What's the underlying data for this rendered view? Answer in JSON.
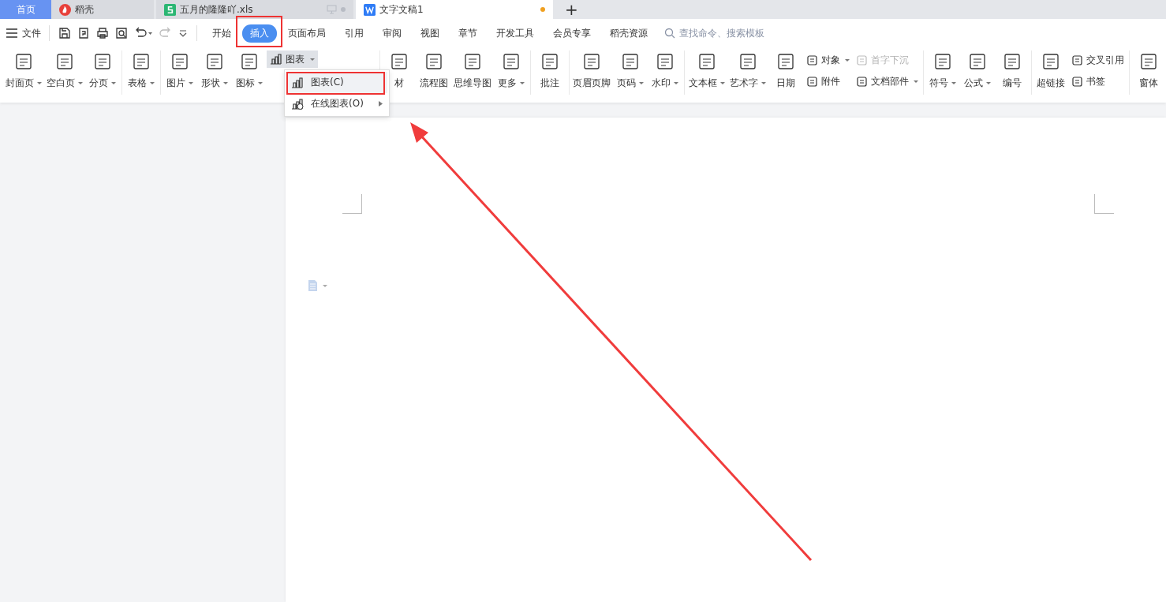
{
  "doc_tabs": [
    {
      "label": "首页",
      "kind": "home",
      "selected": false
    },
    {
      "label": "稻壳",
      "kind": "docer",
      "selected": false
    },
    {
      "label": "五月的隆隆吖.xls",
      "kind": "sheet",
      "selected": false
    },
    {
      "label": "文字文稿1",
      "kind": "doc",
      "selected": true
    },
    {
      "label": "+",
      "kind": "add",
      "selected": false
    }
  ],
  "menu": {
    "file": "文件",
    "tabs": [
      {
        "label": "开始",
        "selected": false
      },
      {
        "label": "插入",
        "selected": true
      },
      {
        "label": "页面布局",
        "selected": false
      },
      {
        "label": "引用",
        "selected": false
      },
      {
        "label": "审阅",
        "selected": false
      },
      {
        "label": "视图",
        "selected": false
      },
      {
        "label": "章节",
        "selected": false
      },
      {
        "label": "开发工具",
        "selected": false
      },
      {
        "label": "会员专享",
        "selected": false
      },
      {
        "label": "稻壳资源",
        "selected": false
      }
    ],
    "search": {
      "placeholder": "查找命令、搜索模板"
    }
  },
  "ribbon": [
    [
      {
        "kind": "large",
        "label": "封面页",
        "dropdown": true
      },
      {
        "kind": "large",
        "label": "空白页",
        "dropdown": true
      },
      {
        "kind": "large",
        "label": "分页",
        "dropdown": true
      }
    ],
    [
      {
        "kind": "large",
        "label": "表格",
        "dropdown": true
      }
    ],
    [
      {
        "kind": "large",
        "label": "图片",
        "dropdown": true
      },
      {
        "kind": "large",
        "label": "形状",
        "dropdown": true
      },
      {
        "kind": "large",
        "label": "图标",
        "dropdown": true
      },
      {
        "kind": "compact",
        "label": "图表",
        "dropdown": true,
        "selected": true
      }
    ],
    [
      {
        "kind": "large",
        "label": "材",
        "dropdown": false
      },
      {
        "kind": "large",
        "label": "流程图",
        "dropdown": false
      },
      {
        "kind": "large",
        "label": "思维导图",
        "dropdown": false
      },
      {
        "kind": "large",
        "label": "更多",
        "dropdown": true
      }
    ],
    [
      {
        "kind": "large",
        "label": "批注",
        "dropdown": false
      }
    ],
    [
      {
        "kind": "large",
        "label": "页眉页脚",
        "dropdown": false
      },
      {
        "kind": "large",
        "label": "页码",
        "dropdown": true
      },
      {
        "kind": "large",
        "label": "水印",
        "dropdown": true
      }
    ],
    [
      {
        "kind": "large",
        "label": "文本框",
        "dropdown": true
      },
      {
        "kind": "large",
        "label": "艺术字",
        "dropdown": true
      },
      {
        "kind": "large",
        "label": "日期",
        "dropdown": false
      },
      {
        "kind": "stack",
        "items": [
          {
            "label": "对象",
            "dropdown": true,
            "disabled": false
          },
          {
            "label": "附件",
            "dropdown": false,
            "disabled": false
          }
        ]
      },
      {
        "kind": "stack",
        "items": [
          {
            "label": "首字下沉",
            "dropdown": false,
            "disabled": true
          },
          {
            "label": "文档部件",
            "dropdown": true,
            "disabled": false
          }
        ]
      }
    ],
    [
      {
        "kind": "large",
        "label": "符号",
        "dropdown": true
      },
      {
        "kind": "large",
        "label": "公式",
        "dropdown": true
      },
      {
        "kind": "large",
        "label": "编号",
        "dropdown": false
      }
    ],
    [
      {
        "kind": "large",
        "label": "超链接",
        "dropdown": false
      },
      {
        "kind": "stack",
        "items": [
          {
            "label": "交叉引用",
            "dropdown": false,
            "disabled": false
          },
          {
            "label": "书签",
            "dropdown": false,
            "disabled": false
          }
        ]
      }
    ],
    [
      {
        "kind": "large",
        "label": "窗体",
        "dropdown": false
      }
    ]
  ],
  "chart_menu": [
    {
      "label": "图表(C)",
      "selected": true,
      "submenu": false
    },
    {
      "label": "在线图表(O)",
      "selected": false,
      "submenu": true
    }
  ]
}
